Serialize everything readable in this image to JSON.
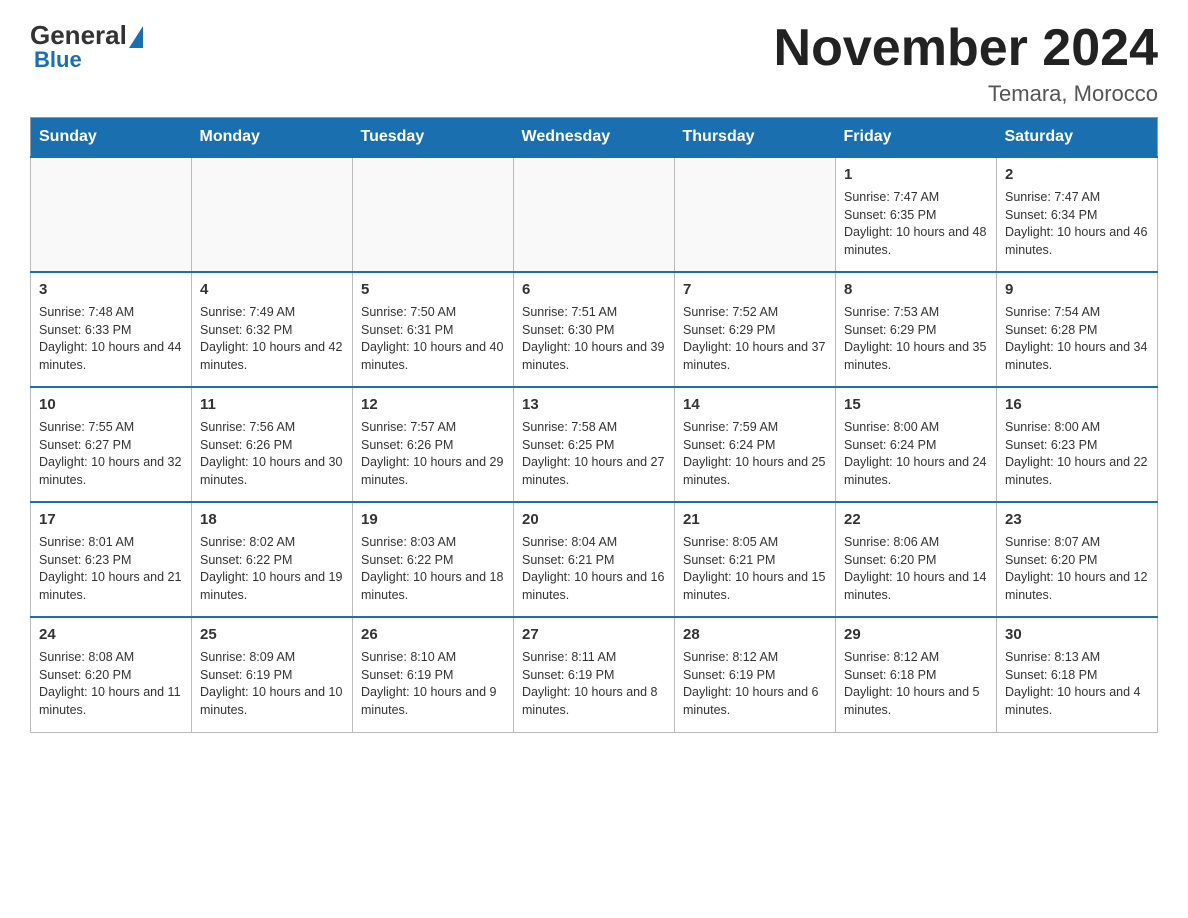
{
  "logo": {
    "general": "General",
    "blue": "Blue"
  },
  "title": "November 2024",
  "location": "Temara, Morocco",
  "days_of_week": [
    "Sunday",
    "Monday",
    "Tuesday",
    "Wednesday",
    "Thursday",
    "Friday",
    "Saturday"
  ],
  "weeks": [
    [
      {
        "day": "",
        "info": ""
      },
      {
        "day": "",
        "info": ""
      },
      {
        "day": "",
        "info": ""
      },
      {
        "day": "",
        "info": ""
      },
      {
        "day": "",
        "info": ""
      },
      {
        "day": "1",
        "info": "Sunrise: 7:47 AM\nSunset: 6:35 PM\nDaylight: 10 hours and 48 minutes."
      },
      {
        "day": "2",
        "info": "Sunrise: 7:47 AM\nSunset: 6:34 PM\nDaylight: 10 hours and 46 minutes."
      }
    ],
    [
      {
        "day": "3",
        "info": "Sunrise: 7:48 AM\nSunset: 6:33 PM\nDaylight: 10 hours and 44 minutes."
      },
      {
        "day": "4",
        "info": "Sunrise: 7:49 AM\nSunset: 6:32 PM\nDaylight: 10 hours and 42 minutes."
      },
      {
        "day": "5",
        "info": "Sunrise: 7:50 AM\nSunset: 6:31 PM\nDaylight: 10 hours and 40 minutes."
      },
      {
        "day": "6",
        "info": "Sunrise: 7:51 AM\nSunset: 6:30 PM\nDaylight: 10 hours and 39 minutes."
      },
      {
        "day": "7",
        "info": "Sunrise: 7:52 AM\nSunset: 6:29 PM\nDaylight: 10 hours and 37 minutes."
      },
      {
        "day": "8",
        "info": "Sunrise: 7:53 AM\nSunset: 6:29 PM\nDaylight: 10 hours and 35 minutes."
      },
      {
        "day": "9",
        "info": "Sunrise: 7:54 AM\nSunset: 6:28 PM\nDaylight: 10 hours and 34 minutes."
      }
    ],
    [
      {
        "day": "10",
        "info": "Sunrise: 7:55 AM\nSunset: 6:27 PM\nDaylight: 10 hours and 32 minutes."
      },
      {
        "day": "11",
        "info": "Sunrise: 7:56 AM\nSunset: 6:26 PM\nDaylight: 10 hours and 30 minutes."
      },
      {
        "day": "12",
        "info": "Sunrise: 7:57 AM\nSunset: 6:26 PM\nDaylight: 10 hours and 29 minutes."
      },
      {
        "day": "13",
        "info": "Sunrise: 7:58 AM\nSunset: 6:25 PM\nDaylight: 10 hours and 27 minutes."
      },
      {
        "day": "14",
        "info": "Sunrise: 7:59 AM\nSunset: 6:24 PM\nDaylight: 10 hours and 25 minutes."
      },
      {
        "day": "15",
        "info": "Sunrise: 8:00 AM\nSunset: 6:24 PM\nDaylight: 10 hours and 24 minutes."
      },
      {
        "day": "16",
        "info": "Sunrise: 8:00 AM\nSunset: 6:23 PM\nDaylight: 10 hours and 22 minutes."
      }
    ],
    [
      {
        "day": "17",
        "info": "Sunrise: 8:01 AM\nSunset: 6:23 PM\nDaylight: 10 hours and 21 minutes."
      },
      {
        "day": "18",
        "info": "Sunrise: 8:02 AM\nSunset: 6:22 PM\nDaylight: 10 hours and 19 minutes."
      },
      {
        "day": "19",
        "info": "Sunrise: 8:03 AM\nSunset: 6:22 PM\nDaylight: 10 hours and 18 minutes."
      },
      {
        "day": "20",
        "info": "Sunrise: 8:04 AM\nSunset: 6:21 PM\nDaylight: 10 hours and 16 minutes."
      },
      {
        "day": "21",
        "info": "Sunrise: 8:05 AM\nSunset: 6:21 PM\nDaylight: 10 hours and 15 minutes."
      },
      {
        "day": "22",
        "info": "Sunrise: 8:06 AM\nSunset: 6:20 PM\nDaylight: 10 hours and 14 minutes."
      },
      {
        "day": "23",
        "info": "Sunrise: 8:07 AM\nSunset: 6:20 PM\nDaylight: 10 hours and 12 minutes."
      }
    ],
    [
      {
        "day": "24",
        "info": "Sunrise: 8:08 AM\nSunset: 6:20 PM\nDaylight: 10 hours and 11 minutes."
      },
      {
        "day": "25",
        "info": "Sunrise: 8:09 AM\nSunset: 6:19 PM\nDaylight: 10 hours and 10 minutes."
      },
      {
        "day": "26",
        "info": "Sunrise: 8:10 AM\nSunset: 6:19 PM\nDaylight: 10 hours and 9 minutes."
      },
      {
        "day": "27",
        "info": "Sunrise: 8:11 AM\nSunset: 6:19 PM\nDaylight: 10 hours and 8 minutes."
      },
      {
        "day": "28",
        "info": "Sunrise: 8:12 AM\nSunset: 6:19 PM\nDaylight: 10 hours and 6 minutes."
      },
      {
        "day": "29",
        "info": "Sunrise: 8:12 AM\nSunset: 6:18 PM\nDaylight: 10 hours and 5 minutes."
      },
      {
        "day": "30",
        "info": "Sunrise: 8:13 AM\nSunset: 6:18 PM\nDaylight: 10 hours and 4 minutes."
      }
    ]
  ]
}
